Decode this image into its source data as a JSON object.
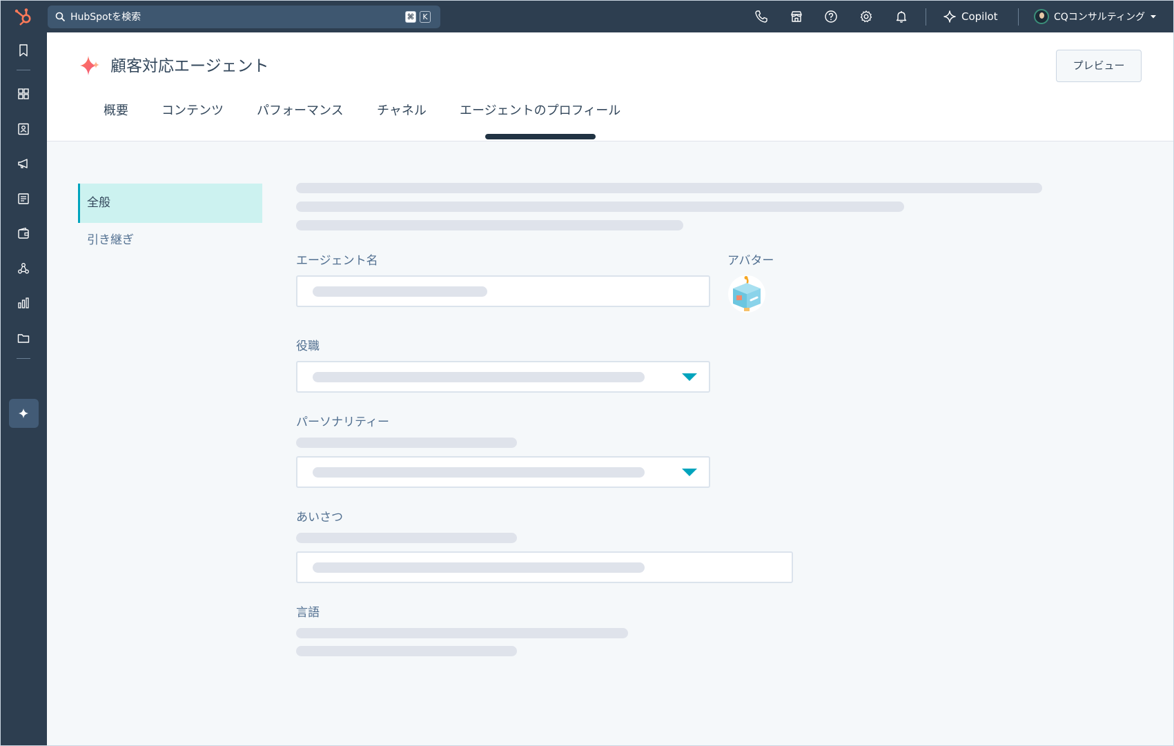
{
  "topbar": {
    "search_placeholder": "HubSpotを検索",
    "shortcut_key_1": "⌘",
    "shortcut_key_2": "K",
    "copilot_label": "Copilot",
    "account_name": "CQコンサルティング"
  },
  "header": {
    "title": "顧客対応エージェント",
    "preview_button": "プレビュー",
    "tabs": [
      {
        "label": "概要"
      },
      {
        "label": "コンテンツ"
      },
      {
        "label": "パフォーマンス"
      },
      {
        "label": "チャネル"
      },
      {
        "label": "エージェントのプロフィール",
        "active": true
      }
    ]
  },
  "sidebar": {
    "items": [
      {
        "label": "全般",
        "active": true
      },
      {
        "label": "引き継ぎ",
        "active": false
      }
    ]
  },
  "form": {
    "agent_name_label": "エージェント名",
    "avatar_label": "アバター",
    "role_label": "役職",
    "personality_label": "パーソナリティー",
    "greeting_label": "あいさつ",
    "language_label": "言語"
  },
  "colors": {
    "nav_bg": "#2d3e50",
    "accent_teal": "#00a4bd",
    "active_item_bg": "#ccf2f0",
    "brand_orange": "#ff7a59",
    "page_bg": "#f5f8fa",
    "skeleton": "#dfe3eb"
  },
  "icons": {
    "rail": [
      "bookmark-icon",
      "grid-icon",
      "contacts-icon",
      "megaphone-icon",
      "document-icon",
      "wallet-icon",
      "network-icon",
      "bar-chart-icon",
      "folder-icon",
      "sparkle-icon"
    ],
    "topbar": [
      "phone-icon",
      "marketplace-icon",
      "help-icon",
      "settings-icon",
      "bell-icon"
    ]
  }
}
